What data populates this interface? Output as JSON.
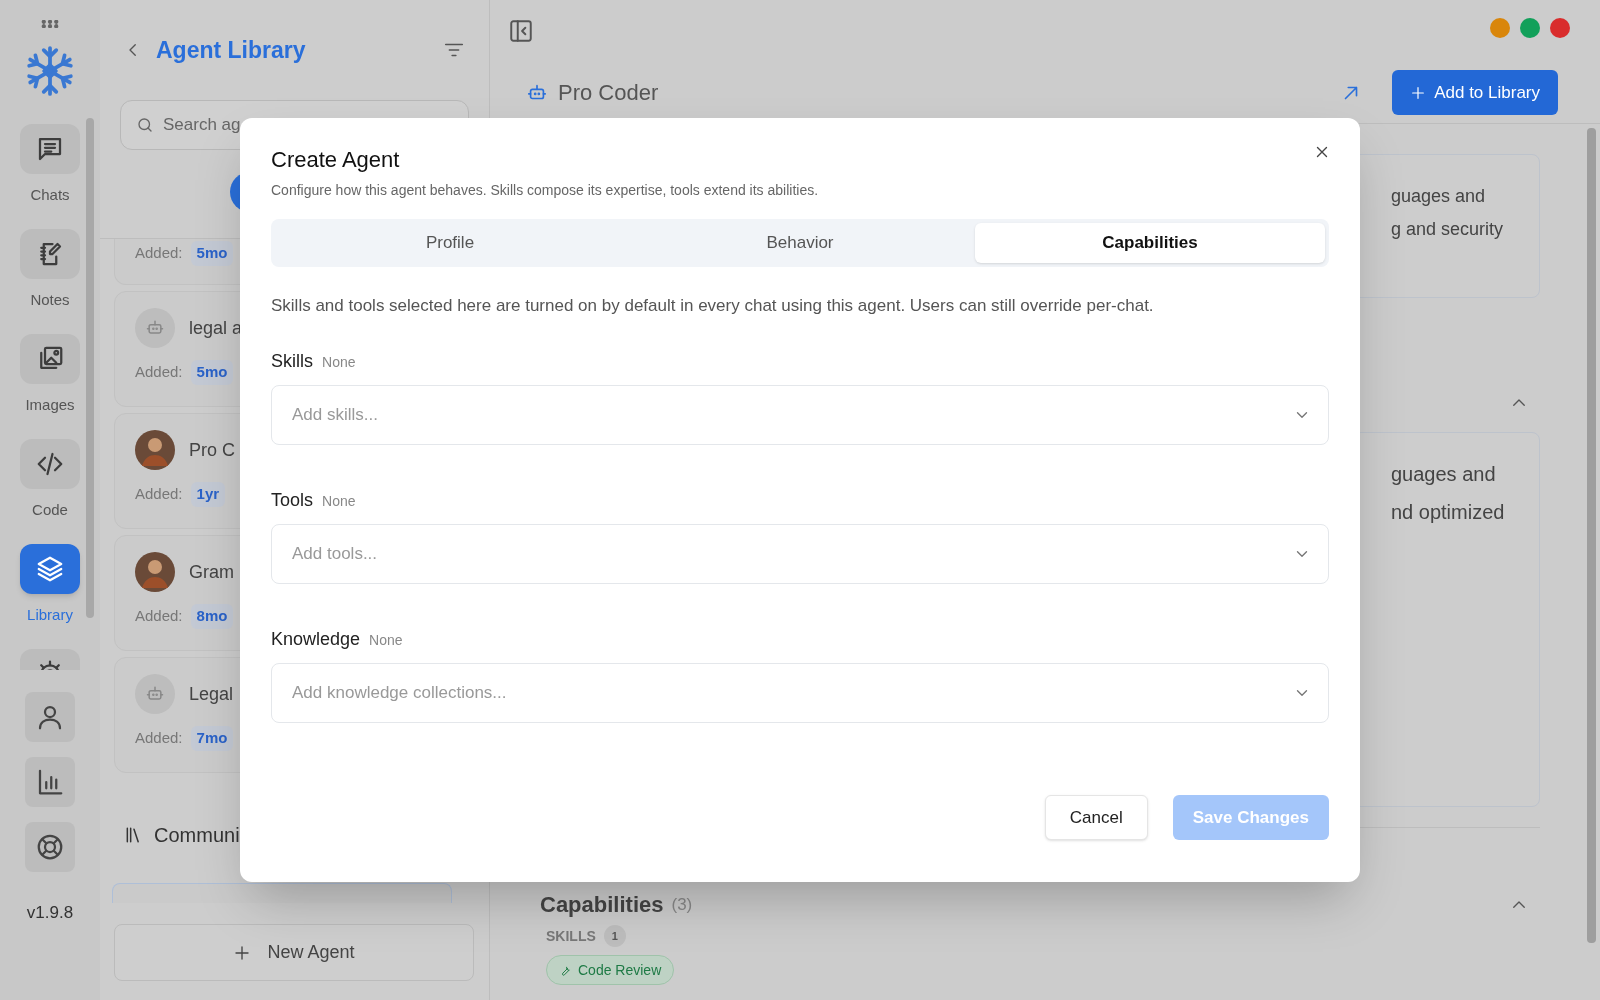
{
  "rail": {
    "items": [
      {
        "kind": "chat",
        "label": "Chats",
        "selected": false
      },
      {
        "kind": "notes",
        "label": "Notes",
        "selected": false
      },
      {
        "kind": "images",
        "label": "Images",
        "selected": false
      },
      {
        "kind": "code",
        "label": "Code",
        "selected": false
      },
      {
        "kind": "layers",
        "label": "Library",
        "selected": true
      },
      {
        "kind": "gear",
        "selected": false
      }
    ],
    "bottom_icons": [
      {
        "kind": "person"
      },
      {
        "kind": "chart"
      },
      {
        "kind": "lifebuoy"
      }
    ],
    "version": "v1.9.8"
  },
  "library_panel": {
    "title": "Agent Library",
    "search": {
      "placeholder": "Search ag"
    },
    "agents": [
      {
        "added_label": "Added:",
        "age": "5mo"
      },
      {
        "kind": "robot",
        "name": "legal a",
        "added_label": "Added:",
        "age": "5mo"
      },
      {
        "kind": "person",
        "name": "Pro C",
        "added_label": "Added:",
        "age": "1yr"
      },
      {
        "kind": "person",
        "name": "Gram",
        "added_label": "Added:",
        "age": "8mo"
      },
      {
        "kind": "robot",
        "name": "Legal",
        "added_label": "Added:",
        "age": "7mo"
      }
    ],
    "section_title": "Communi",
    "new_agent": "New Agent"
  },
  "main": {
    "title": "Pro Coder",
    "add_button": "Add to Library",
    "window_controls": [
      {
        "color": "#d9860b"
      },
      {
        "color": "#12a05a"
      },
      {
        "color": "#d92c2c"
      }
    ],
    "cards": [
      {
        "lines": [
          "guages and",
          "g and security"
        ]
      },
      {
        "lines": [
          "guages and",
          "nd optimized"
        ]
      }
    ],
    "capabilities": {
      "title": "Capabilities",
      "count": "(3)",
      "skills_label": "SKILLS",
      "skills_count": "1",
      "skills": [
        "Code Review"
      ]
    }
  },
  "modal": {
    "title": "Create Agent",
    "subtitle": "Configure how this agent behaves. Skills compose its expertise, tools extend its abilities.",
    "tabs": [
      {
        "label": "Profile",
        "selected": false
      },
      {
        "label": "Behavior",
        "selected": false
      },
      {
        "label": "Capabilities",
        "selected": true
      }
    ],
    "description": "Skills and tools selected here are turned on by default in every chat using this agent. Users can still override per-chat.",
    "fields": [
      {
        "label": "Skills",
        "status": "None",
        "placeholder": "Add skills..."
      },
      {
        "label": "Tools",
        "status": "None",
        "placeholder": "Add tools..."
      },
      {
        "label": "Knowledge",
        "status": "None",
        "placeholder": "Add knowledge collections..."
      }
    ],
    "buttons": [
      {
        "label": "Cancel",
        "kind": "secondary",
        "disabled": false
      },
      {
        "label": "Save Changes",
        "kind": "primary",
        "disabled": true
      }
    ]
  }
}
